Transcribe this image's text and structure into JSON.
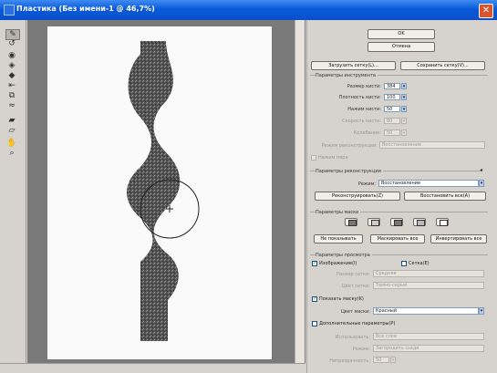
{
  "window": {
    "title": "Пластика (Без имени-1 @ 46,7%)",
    "close_glyph": "✕"
  },
  "actions": {
    "ok": "OK",
    "cancel": "Отмена",
    "load_mesh": "Загрузить сетку(L)...",
    "save_mesh": "Сохранить сетку(V)..."
  },
  "tool_options": {
    "title": "Параметры инструмента",
    "brush_size_label": "Размер кисти:",
    "brush_size_value": "384",
    "brush_density_label": "Плотность кисти:",
    "brush_density_value": "100",
    "brush_pressure_label": "Нажим кисти:",
    "brush_pressure_value": "50",
    "brush_rate_label": "Скорость кисти:",
    "brush_rate_value": "80",
    "turbulent_jitter_label": "Колебание:",
    "turbulent_jitter_value": "50",
    "reconstruct_mode_label": "Режим реконструкции:",
    "reconstruct_mode_value": "Восстановление",
    "stylus_label": "Нажим пера"
  },
  "reconstruct_options": {
    "title": "Параметры реконструкции",
    "mode_label": "Режим:",
    "mode_value": "Восстановление",
    "reconstruct_button": "Реконструировать(Z)",
    "restore_all_button": "Восстановить все(A)"
  },
  "mask_options": {
    "title": "Параметры маски",
    "none_button": "Не показывать",
    "mask_all_button": "Маскировать все",
    "invert_all_button": "Инвертировать все"
  },
  "view_options": {
    "title": "Параметры просмотра",
    "show_image_label": "Изображение(I)",
    "show_image_checked": "✓",
    "mesh_label": "Сетка(E)",
    "mesh_size_label": "Размер сетки:",
    "mesh_size_value": "Средняя",
    "mesh_color_label": "Цвет сетки:",
    "mesh_color_value": "Темно-серый",
    "show_mask_label": "Показать маску(K)",
    "show_mask_checked": "✓",
    "mask_color_label": "Цвет маски:",
    "mask_color_value": "Красный",
    "backdrop_label": "Дополнительные параметры(P)",
    "use_label": "Использовать:",
    "use_value": "Все слои",
    "mode_label": "Режим:",
    "mode_value": "Загородить сзади",
    "opacity_label": "Непрозрачность:",
    "opacity_value": "50"
  },
  "colors": {
    "titlebar": "#0b5ad9",
    "panel": "#d6d3ce",
    "canvas_backdrop": "#7a7a7a",
    "shape": "#5a5a5a"
  },
  "icons": [
    "forward-warp-icon",
    "reconstruct-icon",
    "twirl-icon",
    "pucker-icon",
    "bloat-icon",
    "push-left-icon",
    "mirror-icon",
    "turbulence-icon",
    "freeze-mask-icon",
    "thaw-mask-icon",
    "hand-icon",
    "zoom-icon"
  ]
}
